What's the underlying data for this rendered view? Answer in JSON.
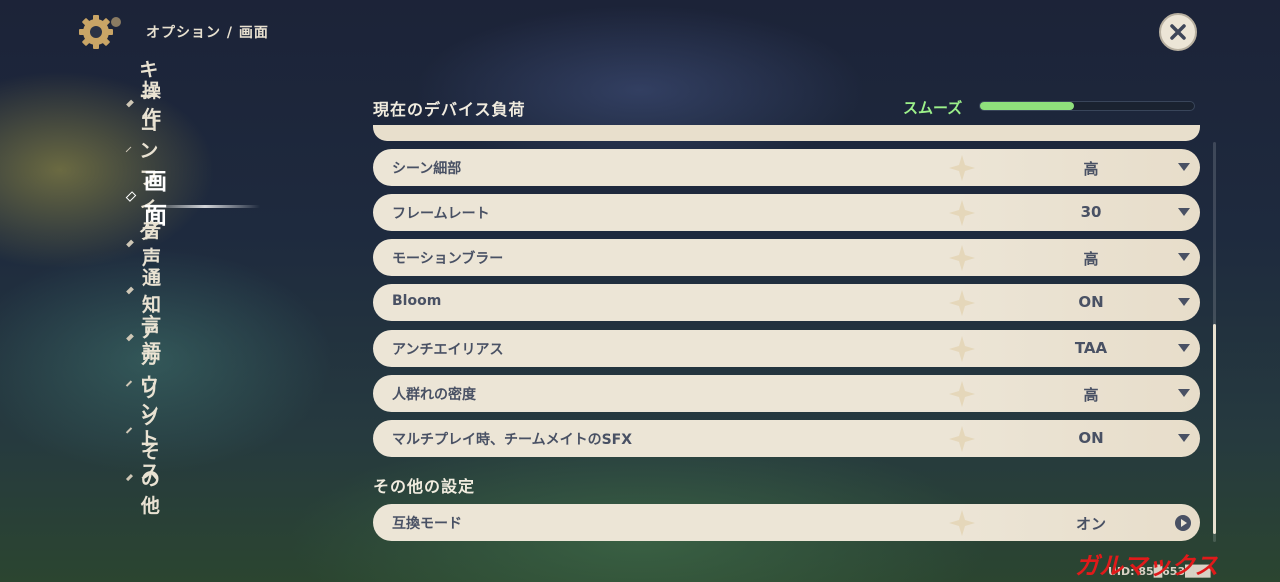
{
  "header": {
    "breadcrumb": "オプション / 画面",
    "settings_icon": "gear-icon",
    "close_icon": "close-icon"
  },
  "sidebar": {
    "items": [
      {
        "label": "操作",
        "active": false
      },
      {
        "label": "キーコンフィグ",
        "active": false
      },
      {
        "label": "画面",
        "active": true
      },
      {
        "label": "音声",
        "active": false
      },
      {
        "label": "通知",
        "active": false
      },
      {
        "label": "言語",
        "active": false
      },
      {
        "label": "アカウント",
        "active": false
      },
      {
        "label": "リソース",
        "active": false
      },
      {
        "label": "その他",
        "active": false
      }
    ]
  },
  "device_load": {
    "title": "現在のデバイス負荷",
    "status": "スムーズ",
    "level_fraction": 0.44,
    "status_color": "#9cf08a"
  },
  "settings": [
    {
      "label": "シーン細部",
      "value": "高",
      "control": "dropdown"
    },
    {
      "label": "フレームレート",
      "value": "30",
      "control": "dropdown"
    },
    {
      "label": "モーションブラー",
      "value": "高",
      "control": "dropdown"
    },
    {
      "label": "Bloom",
      "value": "ON",
      "control": "dropdown"
    },
    {
      "label": "アンチエイリアス",
      "value": "TAA",
      "control": "dropdown"
    },
    {
      "label": "人群れの密度",
      "value": "高",
      "control": "dropdown"
    },
    {
      "label": "マルチプレイ時、チームメイトのSFX",
      "value": "ON",
      "control": "dropdown"
    }
  ],
  "other_settings": {
    "title": "その他の設定",
    "items": [
      {
        "label": "互換モード",
        "value": "オン",
        "control": "next"
      }
    ]
  },
  "footer": {
    "uid": "UID: 85█653███",
    "watermark": "ガルマックス"
  }
}
